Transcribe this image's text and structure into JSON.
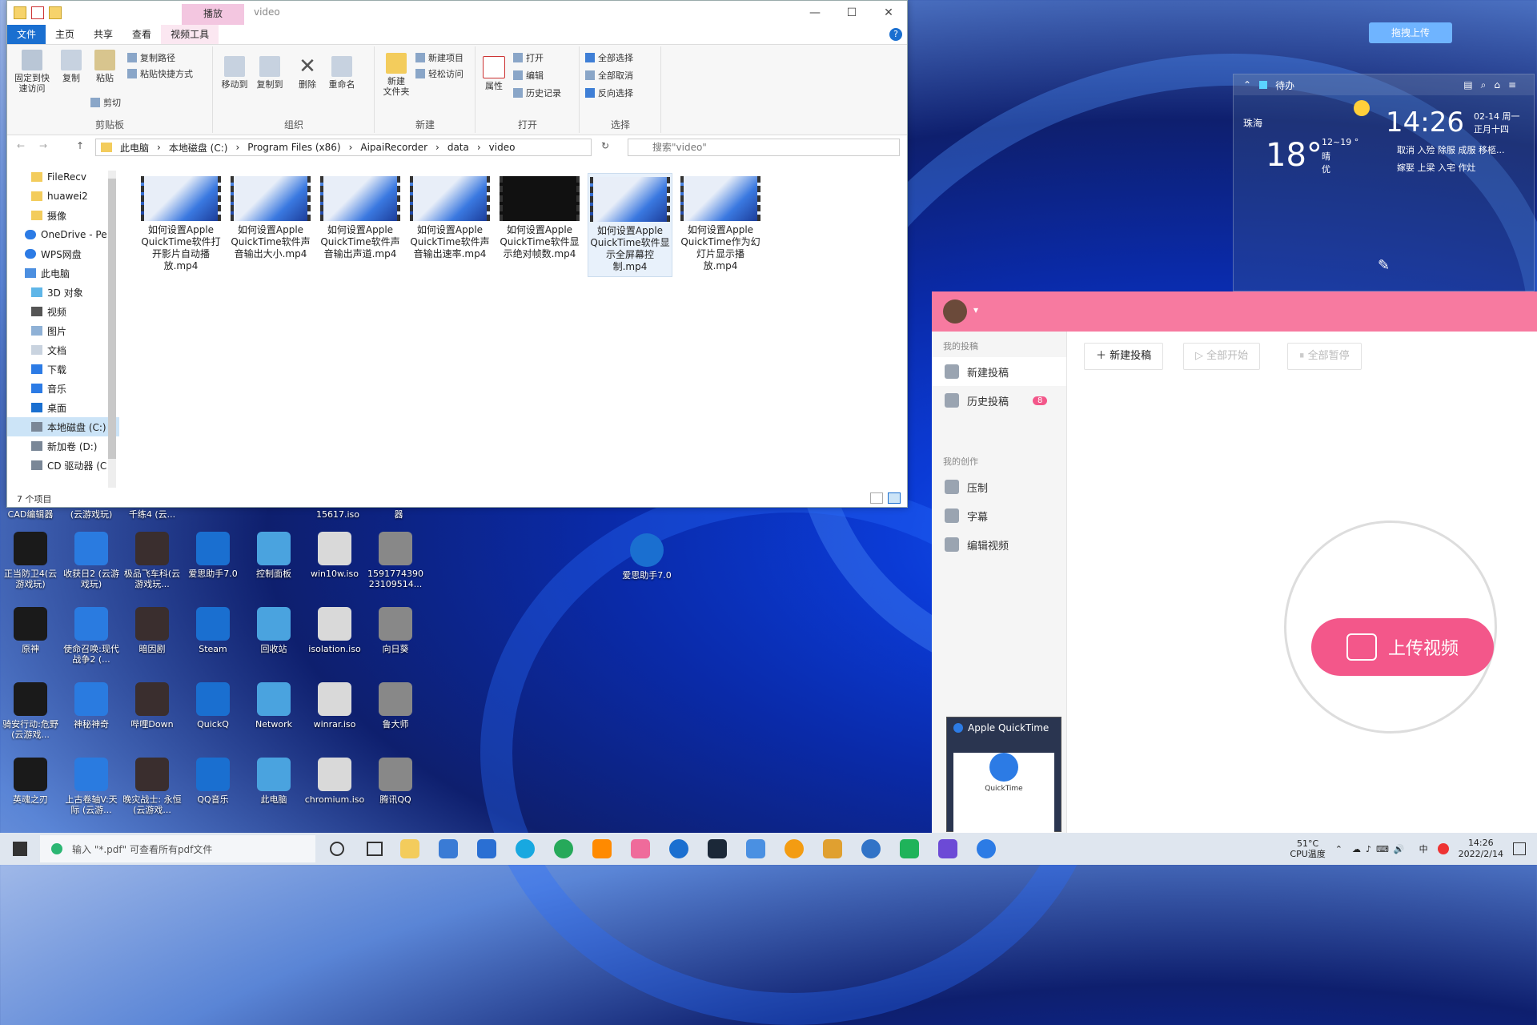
{
  "explorer": {
    "context_tab": "播放",
    "window_title": "video",
    "tabs": [
      "文件",
      "主页",
      "共享",
      "查看",
      "视频工具"
    ],
    "ribbon": {
      "clipboard": {
        "pin": "固定到快\n速访问",
        "copy": "复制",
        "paste": "粘贴",
        "copy_path": "复制路径",
        "paste_shortcut": "粘贴快捷方式",
        "cut": "剪切",
        "label": "剪贴板"
      },
      "organize": {
        "move_to": "移动到",
        "copy_to": "复制到",
        "delete": "删除",
        "rename": "重命名",
        "label": "组织"
      },
      "new": {
        "new_folder": "新建\n文件夹",
        "new_item": "新建项目",
        "easy_access": "轻松访问",
        "label": "新建"
      },
      "open": {
        "properties": "属性",
        "open": "打开",
        "edit": "编辑",
        "history": "历史记录",
        "label": "打开"
      },
      "select": {
        "select_all": "全部选择",
        "select_none": "全部取消",
        "invert": "反向选择",
        "label": "选择"
      }
    },
    "breadcrumb": [
      "此电脑",
      "本地磁盘 (C:)",
      "Program Files (x86)",
      "AipaiRecorder",
      "data",
      "video"
    ],
    "search_placeholder": "搜索\"video\"",
    "nav": [
      "FileRecv",
      "huawei2",
      "摄像",
      "OneDrive - Pe",
      "WPS网盘",
      "此电脑",
      "3D 对象",
      "视频",
      "图片",
      "文档",
      "下载",
      "音乐",
      "桌面",
      "本地磁盘 (C:)",
      "新加卷 (D:)",
      "CD 驱动器 (C"
    ],
    "files": [
      {
        "name": "如何设置Apple QuickTime软件打开影片自动播放.mp4",
        "dark": false
      },
      {
        "name": "如何设置Apple QuickTime软件声音输出大小.mp4",
        "dark": false
      },
      {
        "name": "如何设置Apple QuickTime软件声音输出声道.mp4",
        "dark": false
      },
      {
        "name": "如何设置Apple QuickTime软件声音输出速率.mp4",
        "dark": false
      },
      {
        "name": "如何设置Apple QuickTime软件显示绝对帧数.mp4",
        "dark": true
      },
      {
        "name": "如何设置Apple QuickTime软件显示全屏幕控制.mp4",
        "dark": false
      },
      {
        "name": "如何设置Apple QuickTime作为幻灯片显示播放.mp4",
        "dark": false
      }
    ],
    "status": "7 个项目"
  },
  "desktop_partial_labels": [
    "CAD编辑器",
    "(云游戏玩)",
    "千练4 (云...",
    "15617.iso",
    "器"
  ],
  "desktop_icons": [
    [
      "正当防卫4(云游戏玩)",
      "收获日2 (云游戏玩)",
      "极品飞车科(云游戏玩...",
      "爱思助手7.0",
      "控制面板",
      "win10w.iso",
      "1591774390 23109514..."
    ],
    [
      "原神",
      "使命召唤:现代战争2 (...",
      "暗因剧",
      "Steam",
      "回收站",
      "isolation.iso",
      "向日葵"
    ],
    [
      "骑安行动:危野 (云游戏...",
      "神秘神奇",
      "哔哩Down",
      "QuickQ",
      "Network",
      "winrar.iso",
      "鲁大师"
    ],
    [
      "英魂之刃",
      "上古卷轴V:天际 (云游...",
      "晚灾战士: 永恒 (云游戏...",
      "QQ音乐",
      "此电脑",
      "chromium.iso",
      "腾讯QQ"
    ]
  ],
  "desktop_extra_icon": "爱思助手7.0",
  "upload_top_button": "拖拽上传",
  "widget": {
    "todo": "待办",
    "city": "珠海",
    "temp": "18°",
    "range": "12~19 °",
    "cond1": "晴",
    "cond2": "优",
    "time": "14:26",
    "date": "02-14 周一",
    "lunar": "正月十四",
    "yi": "取消 入殓 除服 成服 移柩...",
    "ji": "嫁娶 上梁 入宅 作灶"
  },
  "app": {
    "my_posts": "我的投稿",
    "new_post": "新建投稿",
    "history_post": "历史投稿",
    "history_badge": "8",
    "my_creation": "我的创作",
    "compress": "压制",
    "subtitle": "字幕",
    "edit_video": "编辑视频",
    "btn_new": "新建投稿",
    "btn_start_all": "全部开始",
    "btn_pause_all": "全部暂停",
    "upload_video": "上传视频"
  },
  "preview": {
    "title": "Apple QuickTime",
    "logo_text": "QuickTime"
  },
  "taskbar": {
    "search_placeholder": "输入 \"*.pdf\" 可查看所有pdf文件",
    "cpu_temp": "51°C",
    "cpu_label": "CPU温度",
    "ime": "中",
    "time": "14:26",
    "date": "2022/2/14"
  },
  "colors": {
    "accent_blue": "#1a6fd0",
    "app_pink": "#f77aa0",
    "upload_pink": "#f3578a"
  }
}
